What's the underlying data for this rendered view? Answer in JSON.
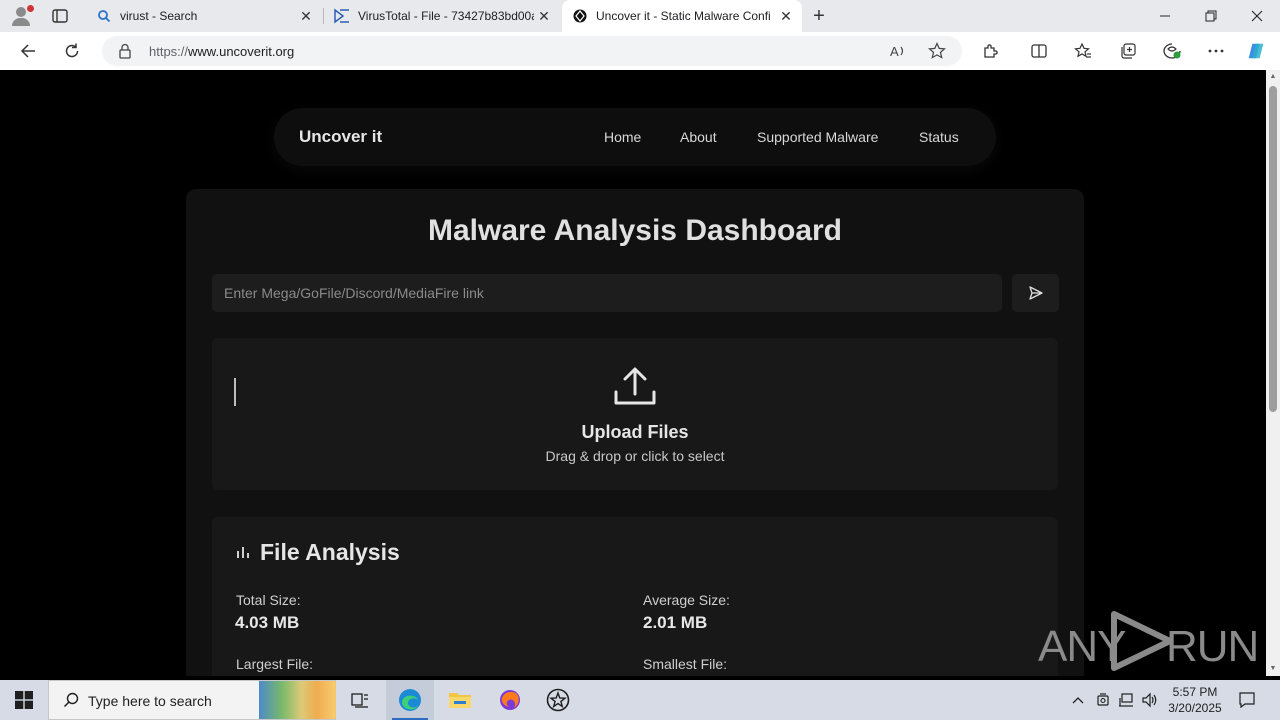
{
  "browser": {
    "tabs": [
      {
        "label": "virust - Search",
        "icon": "search-icon"
      },
      {
        "label": "VirusTotal - File - 73427b83bd00a",
        "icon": "virustotal-icon"
      },
      {
        "label": "Uncover it - Static Malware Confi",
        "icon": "site-favicon",
        "active": true
      }
    ],
    "address": {
      "scheme": "https://",
      "host": "www.uncoverit.org"
    }
  },
  "site": {
    "brand": "Uncover it",
    "nav": [
      "Home",
      "About",
      "Supported Malware",
      "Status"
    ]
  },
  "dashboard": {
    "title": "Malware Analysis Dashboard",
    "link_placeholder": "Enter Mega/GoFile/Discord/MediaFire link",
    "upload_title": "Upload Files",
    "upload_subtitle": "Drag & drop or click to select"
  },
  "analysis": {
    "title": "File Analysis",
    "stats": [
      {
        "label": "Total Size:",
        "value": "4.03 MB"
      },
      {
        "label": "Average Size:",
        "value": "2.01 MB"
      },
      {
        "label": "Largest File:",
        "value": ""
      },
      {
        "label": "Smallest File:",
        "value": ""
      }
    ]
  },
  "watermark": {
    "left": "ANY",
    "right": "RUN"
  },
  "taskbar": {
    "search_placeholder": "Type here to search",
    "time": "5:57 PM",
    "date": "3/20/2025"
  },
  "colors": {
    "page_bg": "#000000",
    "panel_bg": "#111111",
    "card_bg": "#181818",
    "accent_text": "#e0e0e0"
  }
}
